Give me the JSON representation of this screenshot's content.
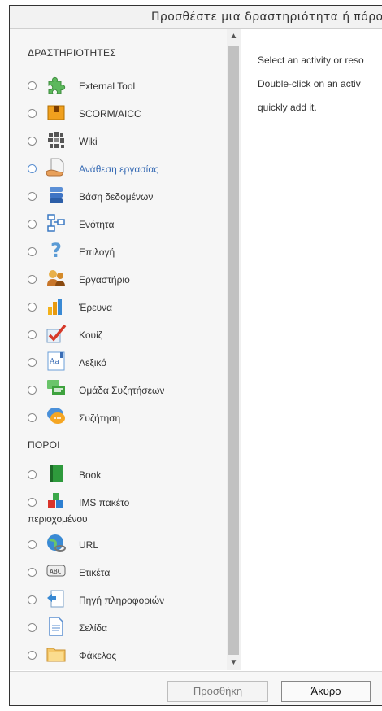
{
  "dialog": {
    "title": "Προσθέστε μια δραστηριότητα ή πόρο"
  },
  "sections": {
    "activities": "ΔΡΑΣΤΗΡΙΟΤΗΤΕΣ",
    "resources": "ΠΟΡΟΙ"
  },
  "activities": [
    {
      "label": "External Tool",
      "icon": "puzzle-icon"
    },
    {
      "label": "SCORM/AICC",
      "icon": "scorm-package-icon"
    },
    {
      "label": "Wiki",
      "icon": "wiki-icon"
    },
    {
      "label": "Ανάθεση εργασίας",
      "icon": "assignment-icon"
    },
    {
      "label": "Βάση δεδομένων",
      "icon": "database-icon"
    },
    {
      "label": "Ενότητα",
      "icon": "lesson-icon"
    },
    {
      "label": "Επιλογή",
      "icon": "question-icon"
    },
    {
      "label": "Εργαστήριο",
      "icon": "workshop-icon"
    },
    {
      "label": "Έρευνα",
      "icon": "survey-icon"
    },
    {
      "label": "Κουίζ",
      "icon": "quiz-icon"
    },
    {
      "label": "Λεξικό",
      "icon": "glossary-icon"
    },
    {
      "label": "Ομάδα Συζητήσεων",
      "icon": "forum-icon"
    },
    {
      "label": "Συζήτηση",
      "icon": "chat-icon"
    }
  ],
  "resources": [
    {
      "label": "Book",
      "icon": "book-icon"
    },
    {
      "label": "IMS πακέτο",
      "label2": "περιοχομένου",
      "icon": "ims-package-icon"
    },
    {
      "label": "URL",
      "icon": "url-icon"
    },
    {
      "label": "Ετικέτα",
      "icon": "label-icon"
    },
    {
      "label": "Πηγή πληροφοριών",
      "icon": "file-icon"
    },
    {
      "label": "Σελίδα",
      "icon": "page-icon"
    },
    {
      "label": "Φάκελος",
      "icon": "folder-icon"
    }
  ],
  "description": {
    "line1": "Select an activity or reso",
    "line2": "Double-click on an activ",
    "line3": "quickly add it."
  },
  "footer": {
    "add_label": "Προσθήκη",
    "cancel_label": "Άκυρο"
  }
}
